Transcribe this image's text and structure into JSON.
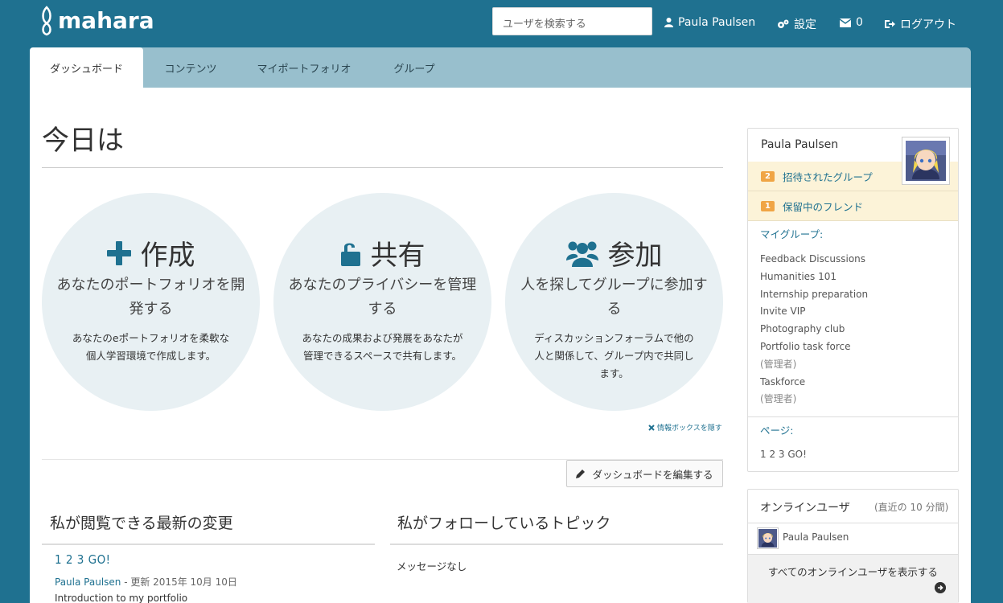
{
  "header": {
    "logo_text": "mahara",
    "search_placeholder": "ユーザを検索する",
    "user_name": "Paula Paulsen",
    "settings_label": "設定",
    "inbox_count": "0",
    "logout_label": "ログアウト"
  },
  "tabs": [
    {
      "label": "ダッシュボード",
      "active": true
    },
    {
      "label": "コンテンツ"
    },
    {
      "label": "マイポートフォリオ"
    },
    {
      "label": "グループ"
    }
  ],
  "main": {
    "title": "今日は",
    "circles": [
      {
        "icon": "plus-icon",
        "heading": "作成",
        "sub": "あなたのポートフォリオを開発する",
        "desc": "あなたのeポートフォリオを柔軟な個人学習環境で作成します。"
      },
      {
        "icon": "unlock-icon",
        "heading": "共有",
        "sub": "あなたのプライバシーを管理する",
        "desc": "あなたの成果および発展をあなたが管理できるスペースで共有します。"
      },
      {
        "icon": "users-icon",
        "heading": "参加",
        "sub": "人を探してグループに参加する",
        "desc": "ディスカッションフォーラムで他の人と関係して、グループ内で共同します。"
      }
    ],
    "hide_info": "情報ボックスを隠す",
    "edit_dashboard": "ダッシュボードを編集する",
    "recent": {
      "title": "私が閲覧できる最新の変更",
      "item_title": "1 2 3 GO!",
      "item_author": "Paula Paulsen",
      "item_meta": " - 更新 2015年 10月 10日",
      "item_desc": "Introduction to my portfolio"
    },
    "topics": {
      "title": "私がフォローしているトピック",
      "empty": "メッセージなし"
    }
  },
  "sidebar": {
    "user_name": "Paula Paulsen",
    "notices": [
      {
        "count": "2",
        "label": "招待されたグループ"
      },
      {
        "count": "1",
        "label": "保留中のフレンド"
      }
    ],
    "my_groups_label": "マイグループ:",
    "groups": [
      {
        "name": "Feedback Discussions"
      },
      {
        "name": "Humanities 101"
      },
      {
        "name": "Internship preparation"
      },
      {
        "name": "Invite VIP"
      },
      {
        "name": "Photography club"
      },
      {
        "name": "Portfolio task force",
        "role": "(管理者)"
      },
      {
        "name": "Taskforce",
        "role": "(管理者)"
      }
    ],
    "pages_label": "ページ:",
    "pages": [
      "1 2 3 GO!"
    ]
  },
  "online": {
    "title": "オンラインユーザ",
    "subtitle": "(直近の 10 分間)",
    "user": "Paula Paulsen",
    "show_all": "すべてのオンラインユーザを表示する"
  },
  "colors": {
    "brand": "#1f7190",
    "tabbar": "#98bfcd",
    "circle_bg": "#e8f0f3",
    "badge": "#f0a545",
    "notice_bg": "#fcf3d8"
  }
}
